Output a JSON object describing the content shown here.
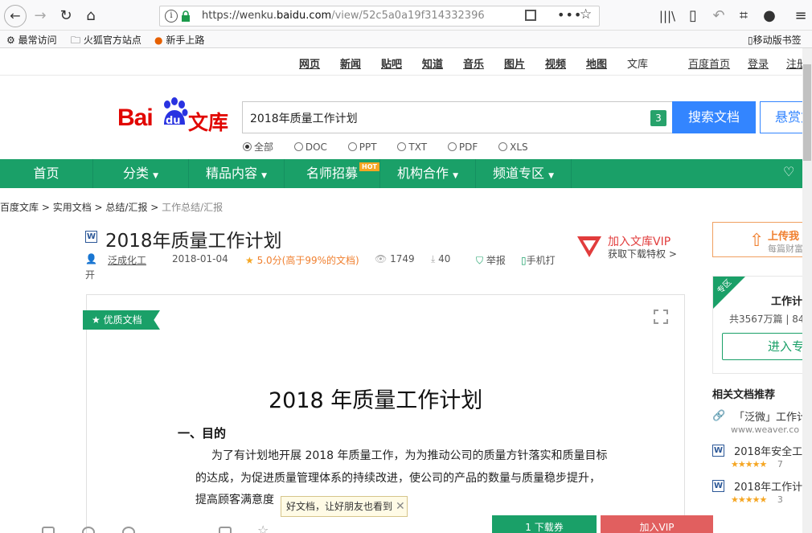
{
  "browser": {
    "url_prefix": "https://wenku.",
    "url_host": "baidu.com",
    "url_rest": "/view/52c5a0a19f314332396",
    "bookmarks": [
      "最常访问",
      "火狐官方站点",
      "新手上路"
    ],
    "mobile_bookmarks": "移动版书签"
  },
  "topnav": {
    "items": [
      "网页",
      "新闻",
      "贴吧",
      "知道",
      "音乐",
      "图片",
      "视频",
      "地图",
      "文库"
    ],
    "home": "百度首页",
    "login": "登录",
    "register": "注册"
  },
  "logo": {
    "bai": "Bai",
    "du": "du",
    "wenku": "文库"
  },
  "search": {
    "value": "2018年质量工作计划",
    "badge": "3",
    "button": "搜索文档",
    "reward": "悬赏文"
  },
  "filters": [
    "全部",
    "DOC",
    "PPT",
    "TXT",
    "PDF",
    "XLS"
  ],
  "green_nav": {
    "items": [
      "首页",
      "分类",
      "精品内容",
      "名师招募",
      "机构合作",
      "频道专区"
    ],
    "hot": "HOT"
  },
  "breadcrumb": [
    "百度文库",
    "实用文档",
    "总结/汇报",
    "工作总结/汇报"
  ],
  "doc": {
    "title": "2018年质量工作计划",
    "author": "泛成化工",
    "author_cont": "开",
    "date": "2018-01-04",
    "rating": "5.0分(高于99%的文档)",
    "views": "1749",
    "downloads": "40",
    "report": "举报",
    "mobile": "手机打",
    "ribbon": "优质文档"
  },
  "vip": {
    "line1": "加入文库VIP",
    "line2": "获取下载特权 >"
  },
  "page": {
    "heading": "2018 年质量工作计划",
    "section1": "一、目的",
    "lines": [
      "为了有计划地开展 2018 年质量工作，为为推动公司的质量方针落实和质量目标",
      "的达成，为促进质量管理体系的持续改进，使公司的产品的数量与质量稳步提升，",
      "提高顾客满意度"
    ],
    "tooltip": "好文档，让好朋友也看到"
  },
  "bottom": {
    "download": "1 下载券",
    "vip": "加入VIP"
  },
  "right": {
    "upload_t1": "上传我",
    "upload_t2": "每篇财富",
    "zone_badge": "专区",
    "zone_title": "工作计",
    "zone_stats": "共3567万篇 | 84",
    "zone_btn": "进入专",
    "related_heading": "相关文档推荐",
    "related": [
      {
        "title": "「泛微」工作计",
        "sub": "www.weaver.co"
      },
      {
        "title": "2018年安全工",
        "sub": "7"
      },
      {
        "title": "2018年工作计",
        "sub": "3"
      }
    ]
  },
  "colors": {
    "green": "#1aa068",
    "blue": "#3385ff",
    "red": "#e10601"
  }
}
